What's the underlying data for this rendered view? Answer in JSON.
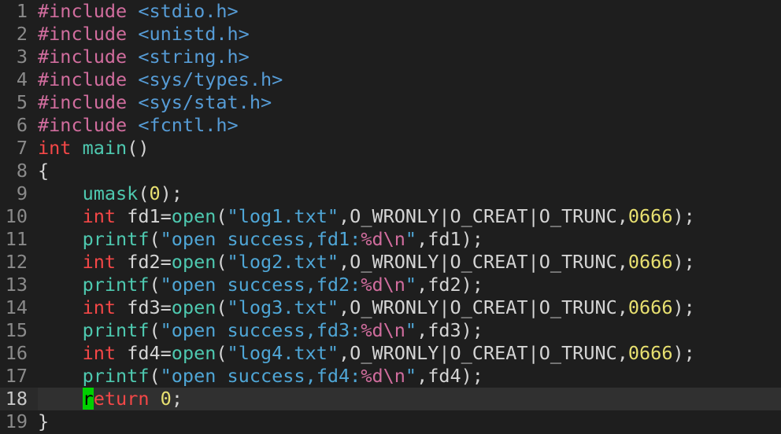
{
  "colors": {
    "background": "#1e1e1e",
    "line_number": "#8a8a8a",
    "preprocessor": "#d16d9e",
    "include_path": "#569cd6",
    "type_keyword": "#f44747",
    "function": "#4ec9b0",
    "number": "#e8e070",
    "string": "#4fa6d6",
    "format_spec": "#d16d9e",
    "cursor": "#00d000",
    "current_line": "#303030"
  },
  "cursor": {
    "line": 18,
    "column": 5
  },
  "lines": [
    {
      "n": "1",
      "tokens": [
        {
          "t": "#include",
          "c": "t-pre"
        },
        {
          "t": " ",
          "c": "t-plain"
        },
        {
          "t": "<stdio.h>",
          "c": "t-inc"
        }
      ]
    },
    {
      "n": "2",
      "tokens": [
        {
          "t": "#include",
          "c": "t-pre"
        },
        {
          "t": " ",
          "c": "t-plain"
        },
        {
          "t": "<unistd.h>",
          "c": "t-inc"
        }
      ]
    },
    {
      "n": "3",
      "tokens": [
        {
          "t": "#include",
          "c": "t-pre"
        },
        {
          "t": " ",
          "c": "t-plain"
        },
        {
          "t": "<string.h>",
          "c": "t-inc"
        }
      ]
    },
    {
      "n": "4",
      "tokens": [
        {
          "t": "#include",
          "c": "t-pre"
        },
        {
          "t": " ",
          "c": "t-plain"
        },
        {
          "t": "<sys/types.h>",
          "c": "t-inc"
        }
      ]
    },
    {
      "n": "5",
      "tokens": [
        {
          "t": "#include",
          "c": "t-pre"
        },
        {
          "t": " ",
          "c": "t-plain"
        },
        {
          "t": "<sys/stat.h>",
          "c": "t-inc"
        }
      ]
    },
    {
      "n": "6",
      "tokens": [
        {
          "t": "#include",
          "c": "t-pre"
        },
        {
          "t": " ",
          "c": "t-plain"
        },
        {
          "t": "<fcntl.h>",
          "c": "t-inc"
        }
      ]
    },
    {
      "n": "7",
      "tokens": [
        {
          "t": "int",
          "c": "t-type"
        },
        {
          "t": " ",
          "c": "t-plain"
        },
        {
          "t": "main",
          "c": "t-fn"
        },
        {
          "t": "()",
          "c": "t-punct"
        }
      ]
    },
    {
      "n": "8",
      "tokens": [
        {
          "t": "{",
          "c": "t-punct"
        }
      ]
    },
    {
      "n": "9",
      "tokens": [
        {
          "t": "    ",
          "c": "t-plain"
        },
        {
          "t": "umask",
          "c": "t-fn"
        },
        {
          "t": "(",
          "c": "t-punct"
        },
        {
          "t": "0",
          "c": "t-num"
        },
        {
          "t": ");",
          "c": "t-punct"
        }
      ]
    },
    {
      "n": "10",
      "tokens": [
        {
          "t": "    ",
          "c": "t-plain"
        },
        {
          "t": "int",
          "c": "t-type"
        },
        {
          "t": " fd1=",
          "c": "t-plain"
        },
        {
          "t": "open",
          "c": "t-fn"
        },
        {
          "t": "(",
          "c": "t-punct"
        },
        {
          "t": "\"log1.txt\"",
          "c": "t-str"
        },
        {
          "t": ",O_WRONLY|O_CREAT|O_TRUNC,",
          "c": "t-plain"
        },
        {
          "t": "0666",
          "c": "t-num"
        },
        {
          "t": ");",
          "c": "t-punct"
        }
      ]
    },
    {
      "n": "11",
      "tokens": [
        {
          "t": "    ",
          "c": "t-plain"
        },
        {
          "t": "printf",
          "c": "t-fn"
        },
        {
          "t": "(",
          "c": "t-punct"
        },
        {
          "t": "\"open success,fd1:",
          "c": "t-str"
        },
        {
          "t": "%d\\n",
          "c": "t-fmt"
        },
        {
          "t": "\"",
          "c": "t-str"
        },
        {
          "t": ",fd1);",
          "c": "t-plain"
        }
      ]
    },
    {
      "n": "12",
      "tokens": [
        {
          "t": "    ",
          "c": "t-plain"
        },
        {
          "t": "int",
          "c": "t-type"
        },
        {
          "t": " fd2=",
          "c": "t-plain"
        },
        {
          "t": "open",
          "c": "t-fn"
        },
        {
          "t": "(",
          "c": "t-punct"
        },
        {
          "t": "\"log2.txt\"",
          "c": "t-str"
        },
        {
          "t": ",O_WRONLY|O_CREAT|O_TRUNC,",
          "c": "t-plain"
        },
        {
          "t": "0666",
          "c": "t-num"
        },
        {
          "t": ");",
          "c": "t-punct"
        }
      ]
    },
    {
      "n": "13",
      "tokens": [
        {
          "t": "    ",
          "c": "t-plain"
        },
        {
          "t": "printf",
          "c": "t-fn"
        },
        {
          "t": "(",
          "c": "t-punct"
        },
        {
          "t": "\"open success,fd2:",
          "c": "t-str"
        },
        {
          "t": "%d\\n",
          "c": "t-fmt"
        },
        {
          "t": "\"",
          "c": "t-str"
        },
        {
          "t": ",fd2);",
          "c": "t-plain"
        }
      ]
    },
    {
      "n": "14",
      "tokens": [
        {
          "t": "    ",
          "c": "t-plain"
        },
        {
          "t": "int",
          "c": "t-type"
        },
        {
          "t": " fd3=",
          "c": "t-plain"
        },
        {
          "t": "open",
          "c": "t-fn"
        },
        {
          "t": "(",
          "c": "t-punct"
        },
        {
          "t": "\"log3.txt\"",
          "c": "t-str"
        },
        {
          "t": ",O_WRONLY|O_CREAT|O_TRUNC,",
          "c": "t-plain"
        },
        {
          "t": "0666",
          "c": "t-num"
        },
        {
          "t": ");",
          "c": "t-punct"
        }
      ]
    },
    {
      "n": "15",
      "tokens": [
        {
          "t": "    ",
          "c": "t-plain"
        },
        {
          "t": "printf",
          "c": "t-fn"
        },
        {
          "t": "(",
          "c": "t-punct"
        },
        {
          "t": "\"open success,fd3:",
          "c": "t-str"
        },
        {
          "t": "%d\\n",
          "c": "t-fmt"
        },
        {
          "t": "\"",
          "c": "t-str"
        },
        {
          "t": ",fd3);",
          "c": "t-plain"
        }
      ]
    },
    {
      "n": "16",
      "tokens": [
        {
          "t": "    ",
          "c": "t-plain"
        },
        {
          "t": "int",
          "c": "t-type"
        },
        {
          "t": " fd4=",
          "c": "t-plain"
        },
        {
          "t": "open",
          "c": "t-fn"
        },
        {
          "t": "(",
          "c": "t-punct"
        },
        {
          "t": "\"log4.txt\"",
          "c": "t-str"
        },
        {
          "t": ",O_WRONLY|O_CREAT|O_TRUNC,",
          "c": "t-plain"
        },
        {
          "t": "0666",
          "c": "t-num"
        },
        {
          "t": ");",
          "c": "t-punct"
        }
      ]
    },
    {
      "n": "17",
      "tokens": [
        {
          "t": "    ",
          "c": "t-plain"
        },
        {
          "t": "printf",
          "c": "t-fn"
        },
        {
          "t": "(",
          "c": "t-punct"
        },
        {
          "t": "\"open success,fd4:",
          "c": "t-str"
        },
        {
          "t": "%d\\n",
          "c": "t-fmt"
        },
        {
          "t": "\"",
          "c": "t-str"
        },
        {
          "t": ",fd4);",
          "c": "t-plain"
        }
      ]
    },
    {
      "n": "18",
      "current": true,
      "tokens": [
        {
          "t": "    ",
          "c": "t-plain"
        },
        {
          "t": "r",
          "c": "t-kw cursor"
        },
        {
          "t": "eturn",
          "c": "t-kw"
        },
        {
          "t": " ",
          "c": "t-plain"
        },
        {
          "t": "0",
          "c": "t-num"
        },
        {
          "t": ";",
          "c": "t-punct"
        }
      ]
    },
    {
      "n": "19",
      "tokens": [
        {
          "t": "}",
          "c": "t-punct"
        }
      ]
    }
  ]
}
